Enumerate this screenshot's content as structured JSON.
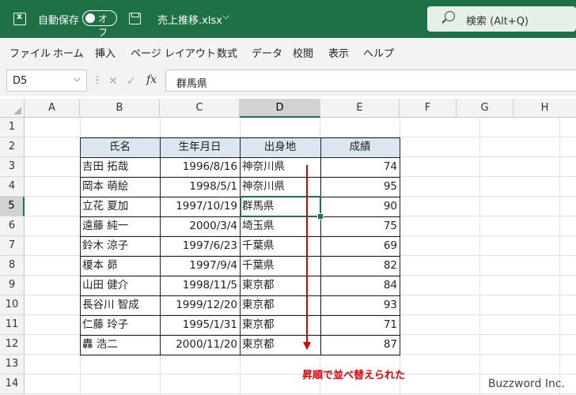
{
  "titlebar": {
    "autosave_label": "自動保存",
    "autosave_state": "オフ",
    "filename": "売上推移.xlsx",
    "search_label": "検索 (Alt+Q)",
    "accent_color": "#1e7145"
  },
  "menu": [
    "ファイル",
    "ホーム",
    "挿入",
    "ページ レイアウト",
    "数式",
    "データ",
    "校閲",
    "表示",
    "ヘルプ"
  ],
  "formula_bar": {
    "name_box": "D5",
    "formula": "群馬県",
    "fx": "fx"
  },
  "grid": {
    "columns": [
      "A",
      "B",
      "C",
      "D",
      "E",
      "F",
      "G",
      "H"
    ],
    "rows": [
      "1",
      "2",
      "3",
      "4",
      "5",
      "6",
      "7",
      "8",
      "9",
      "10",
      "11",
      "12",
      "13",
      "14"
    ],
    "selected_column": "D",
    "selected_row": "5"
  },
  "table": {
    "headers": [
      "氏名",
      "生年月日",
      "出身地",
      "成績"
    ],
    "rows": [
      [
        "吉田 拓哉",
        "1996/8/16",
        "神奈川県",
        "74"
      ],
      [
        "岡本 萌絵",
        "1998/5/1",
        "神奈川県",
        "95"
      ],
      [
        "立花 夏加",
        "1997/10/19",
        "群馬県",
        "90"
      ],
      [
        "遠藤 純一",
        "2000/3/4",
        "埼玉県",
        "75"
      ],
      [
        "鈴木 涼子",
        "1997/6/23",
        "千葉県",
        "69"
      ],
      [
        "榎本 昴",
        "1997/9/4",
        "千葉県",
        "82"
      ],
      [
        "山田 健介",
        "1998/11/5",
        "東京都",
        "84"
      ],
      [
        "長谷川 智成",
        "1999/12/20",
        "東京都",
        "93"
      ],
      [
        "仁藤 玲子",
        "1995/1/31",
        "東京都",
        "71"
      ],
      [
        "轟 浩二",
        "2000/11/20",
        "東京都",
        "87"
      ]
    ],
    "header_fill": "#dce6f1"
  },
  "annotation": {
    "text": "昇順で並べ替えられた",
    "color": "#e00000"
  },
  "watermark": "Buzzword Inc."
}
